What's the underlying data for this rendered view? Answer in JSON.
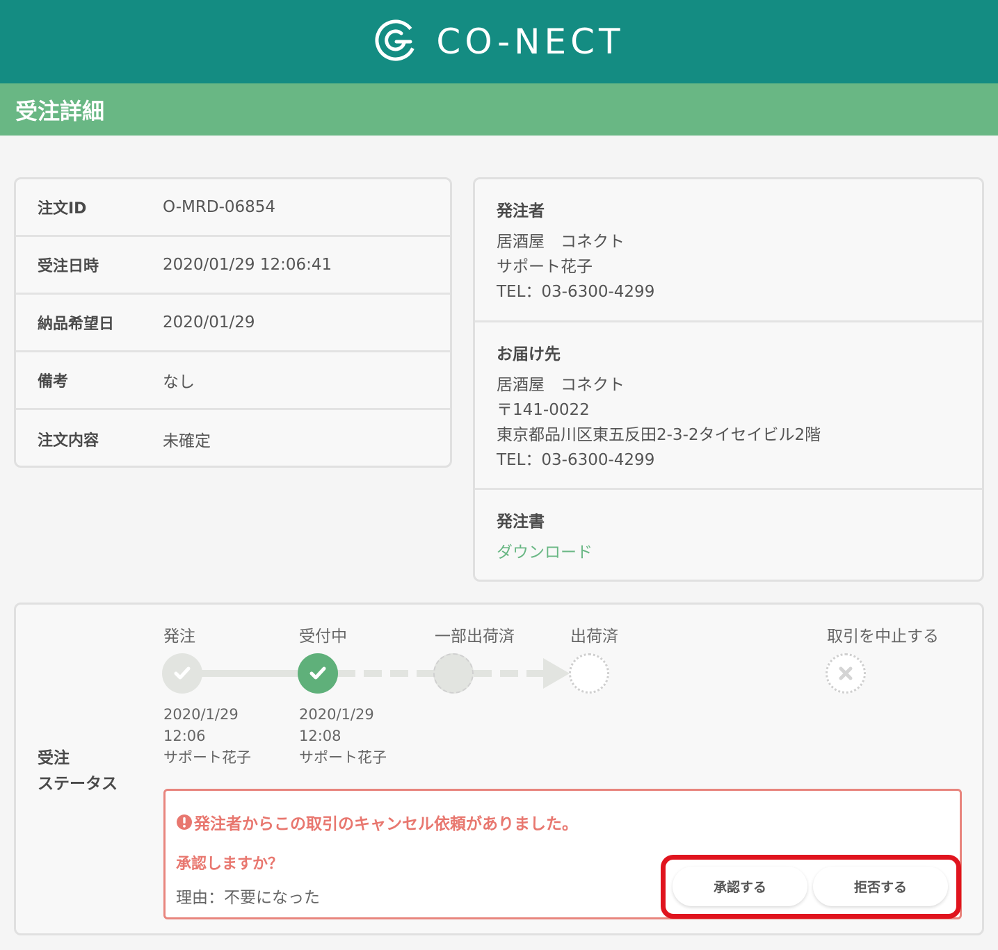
{
  "header": {
    "logo_text": "CO-NECT"
  },
  "page": {
    "title": "受注詳細"
  },
  "order_info": [
    {
      "label": "注文ID",
      "value": "O-MRD-06854"
    },
    {
      "label": "受注日時",
      "value": "2020/01/29 12:06:41"
    },
    {
      "label": "納品希望日",
      "value": "2020/01/29"
    },
    {
      "label": "備考",
      "value": "なし"
    },
    {
      "label": "注文内容",
      "value": "未確定"
    }
  ],
  "orderer": {
    "title": "発注者",
    "name": "居酒屋　コネクト",
    "person": "サポート花子",
    "tel": "TEL：03-6300-4299"
  },
  "delivery": {
    "title": "お届け先",
    "name": "居酒屋　コネクト",
    "postal": "〒141-0022",
    "address": "東京都品川区東五反田2-3-2タイセイビル2階",
    "tel": "TEL：03-6300-4299"
  },
  "purchase_order": {
    "title": "発注書",
    "download_label": "ダウンロード"
  },
  "status": {
    "label_line1": "受注",
    "label_line2": "ステータス",
    "steps": [
      {
        "label": "発注",
        "date": "2020/1/29",
        "time": "12:06",
        "person": "サポート花子",
        "state": "done"
      },
      {
        "label": "受付中",
        "date": "2020/1/29",
        "time": "12:08",
        "person": "サポート花子",
        "state": "active"
      },
      {
        "label": "一部出荷済",
        "state": "pending"
      },
      {
        "label": "出荷済",
        "state": "empty"
      }
    ],
    "cancel_label": "取引を中止する"
  },
  "alert": {
    "message": "発注者からこの取引のキャンセル依頼がありました。",
    "question": "承認しますか？",
    "reason": "理由：不要になった",
    "approve_label": "承認する",
    "reject_label": "拒否する"
  },
  "colors": {
    "header_bg": "#148c82",
    "pagebar_bg": "#69b784",
    "accent_green": "#5fb07a",
    "alert_red": "#e8776f",
    "highlight_red": "#e0141e"
  }
}
